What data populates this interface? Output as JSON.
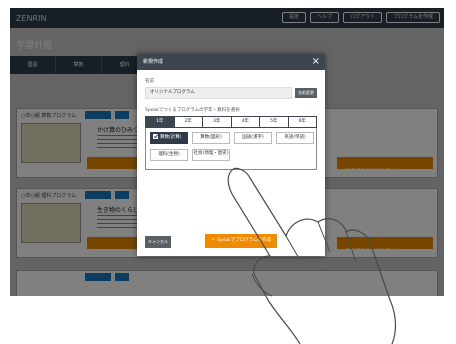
{
  "app": {
    "logo": "ZENRIN",
    "top_buttons": [
      "設定",
      "ヘルプ",
      "ログアウト",
      "プログラムを作成"
    ],
    "page_title": "学習計画",
    "tabs": [
      "国語",
      "算数",
      "理科",
      "社会",
      "英語"
    ],
    "cards": [
      {
        "head": "○年○組 算数プログラム",
        "title": "かけ算のひみつを知ろう",
        "action": "このプログラムを使う"
      },
      {
        "head": "○年○組 理科プログラム",
        "title": "生き物のくらしを調べよう",
        "action": "このプログラムを使う"
      }
    ]
  },
  "modal": {
    "title": "新規作成",
    "close_icon": "close-icon",
    "name_label": "名前",
    "name_value": "オリジナルプログラム",
    "change_label": "名前変更",
    "grade_label": "Speakでつくるプログラムの学年・教科を選択",
    "grades": [
      "1年",
      "2年",
      "3年",
      "4年",
      "5年",
      "6年"
    ],
    "active_grade": 0,
    "subjects": [
      {
        "label": "算数(計算)",
        "selected": true
      },
      {
        "label": "算数(図形)",
        "selected": false
      },
      {
        "label": "国語(漢字)",
        "selected": false
      },
      {
        "label": "英語(単語)",
        "selected": false
      },
      {
        "label": "理科(生物)",
        "selected": false
      },
      {
        "label": "社会(地理・歴史)",
        "selected": false
      }
    ],
    "cancel_label": "キャンセル",
    "create_label": "Speakでプログラムを作成"
  },
  "colors": {
    "header": "#3d4650",
    "accent": "#f08a00",
    "primary": "#2f3b4a"
  }
}
